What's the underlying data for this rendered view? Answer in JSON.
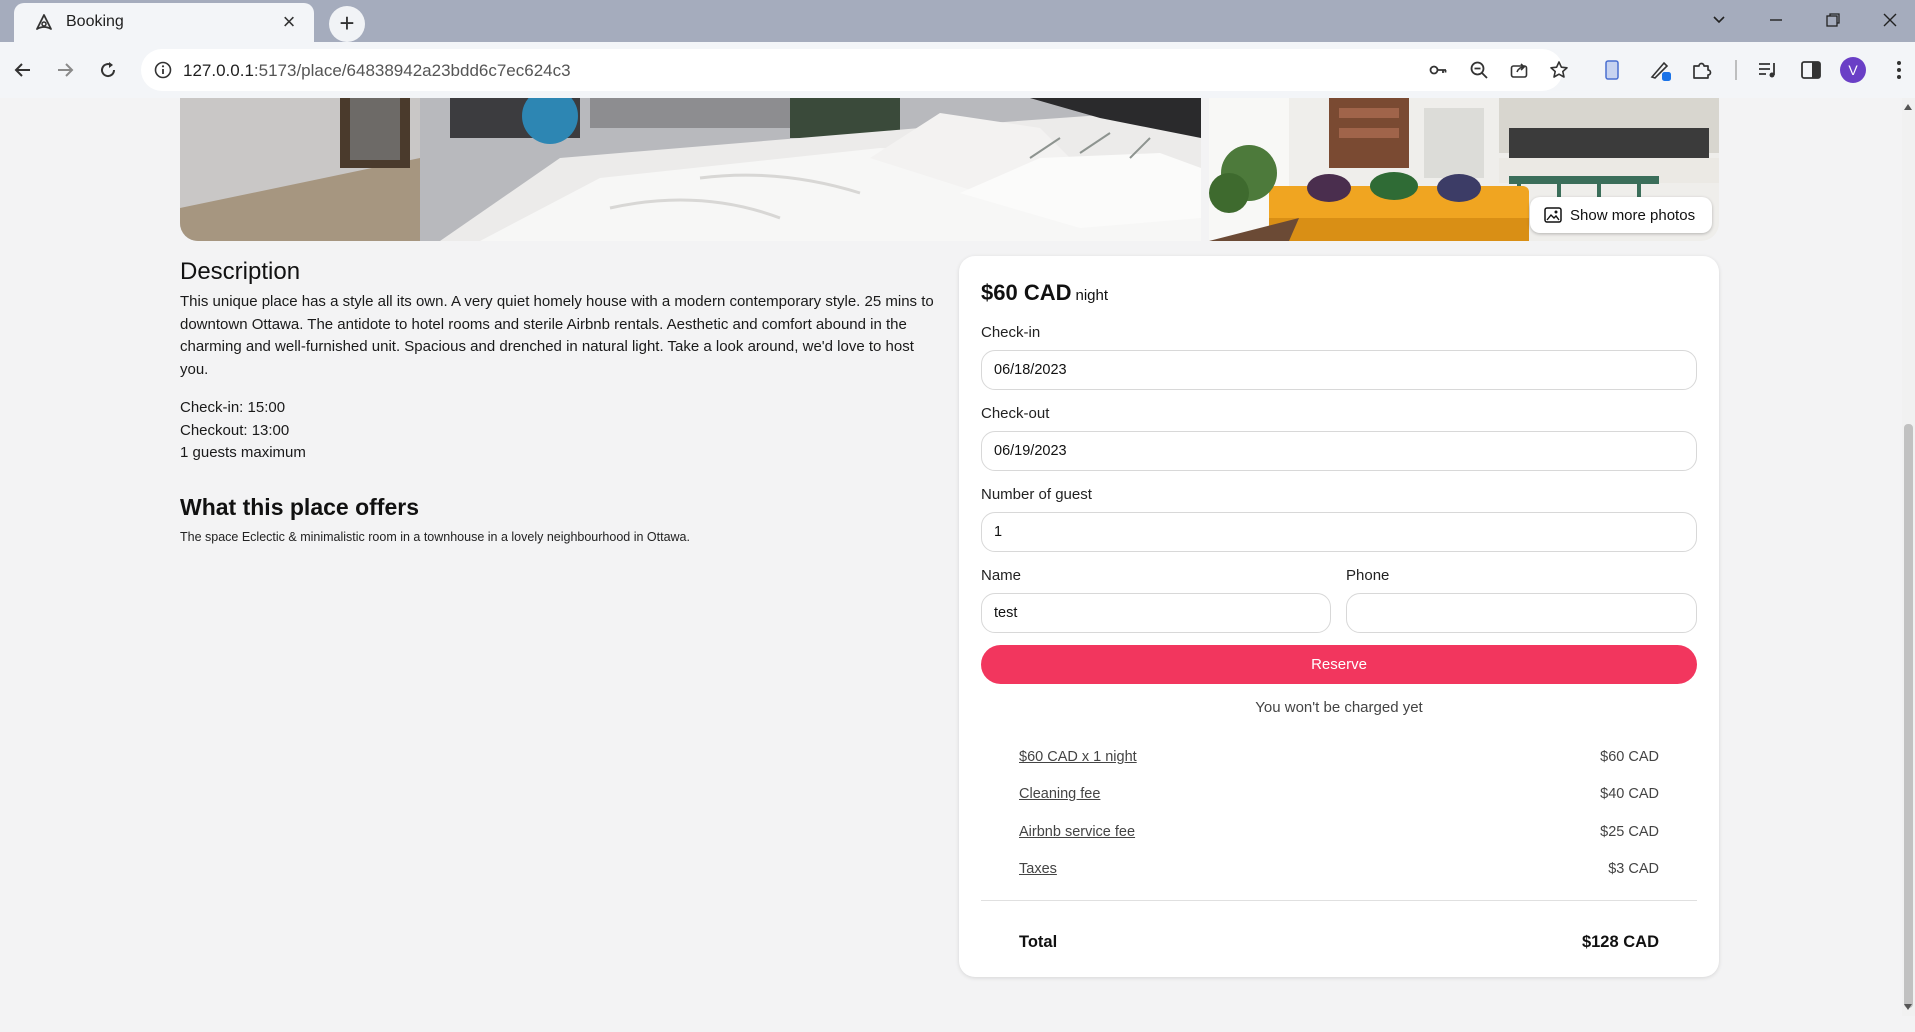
{
  "browser": {
    "tab_title": "Booking",
    "url_host": "127.0.0.1",
    "url_rest": ":5173/place/64838942a23bdd6c7ec624c3",
    "avatar_letter": "V"
  },
  "photos": {
    "show_more_label": "Show more photos"
  },
  "description": {
    "title": "Description",
    "text": "This unique place has a style all its own. A very quiet homely house with a modern contemporary style. 25 mins to downtown Ottawa. The antidote to hotel rooms and sterile Airbnb rentals. Aesthetic and comfort abound in the charming and well-furnished unit. Spacious and drenched in natural light. Take a look around, we'd love to host you.",
    "check_in": "Check-in: 15:00",
    "checkout": "Checkout: 13:00",
    "max_guests": "1 guests maximum"
  },
  "offers": {
    "title": "What this place offers",
    "text": "The space Eclectic & minimalistic room in a townhouse in a lovely neighbourhood in Ottawa."
  },
  "booking": {
    "price": "$60 CAD",
    "price_unit": "night",
    "checkin_label": "Check-in",
    "checkin_value": "06/18/2023",
    "checkout_label": "Check-out",
    "checkout_value": "06/19/2023",
    "guests_label": "Number of guest",
    "guests_value": "1",
    "name_label": "Name",
    "name_value": "test",
    "phone_label": "Phone",
    "phone_value": "",
    "reserve_label": "Reserve",
    "not_charged": "You won't be charged yet",
    "fees": [
      {
        "label": "$60 CAD x 1 night",
        "value": "$60 CAD"
      },
      {
        "label": "Cleaning fee",
        "value": "$40 CAD"
      },
      {
        "label": "Airbnb service fee",
        "value": "$25 CAD"
      },
      {
        "label": "Taxes",
        "value": "$3 CAD"
      }
    ],
    "total_label": "Total",
    "total_value": "$128 CAD",
    "accent_color": "#f2365e"
  }
}
